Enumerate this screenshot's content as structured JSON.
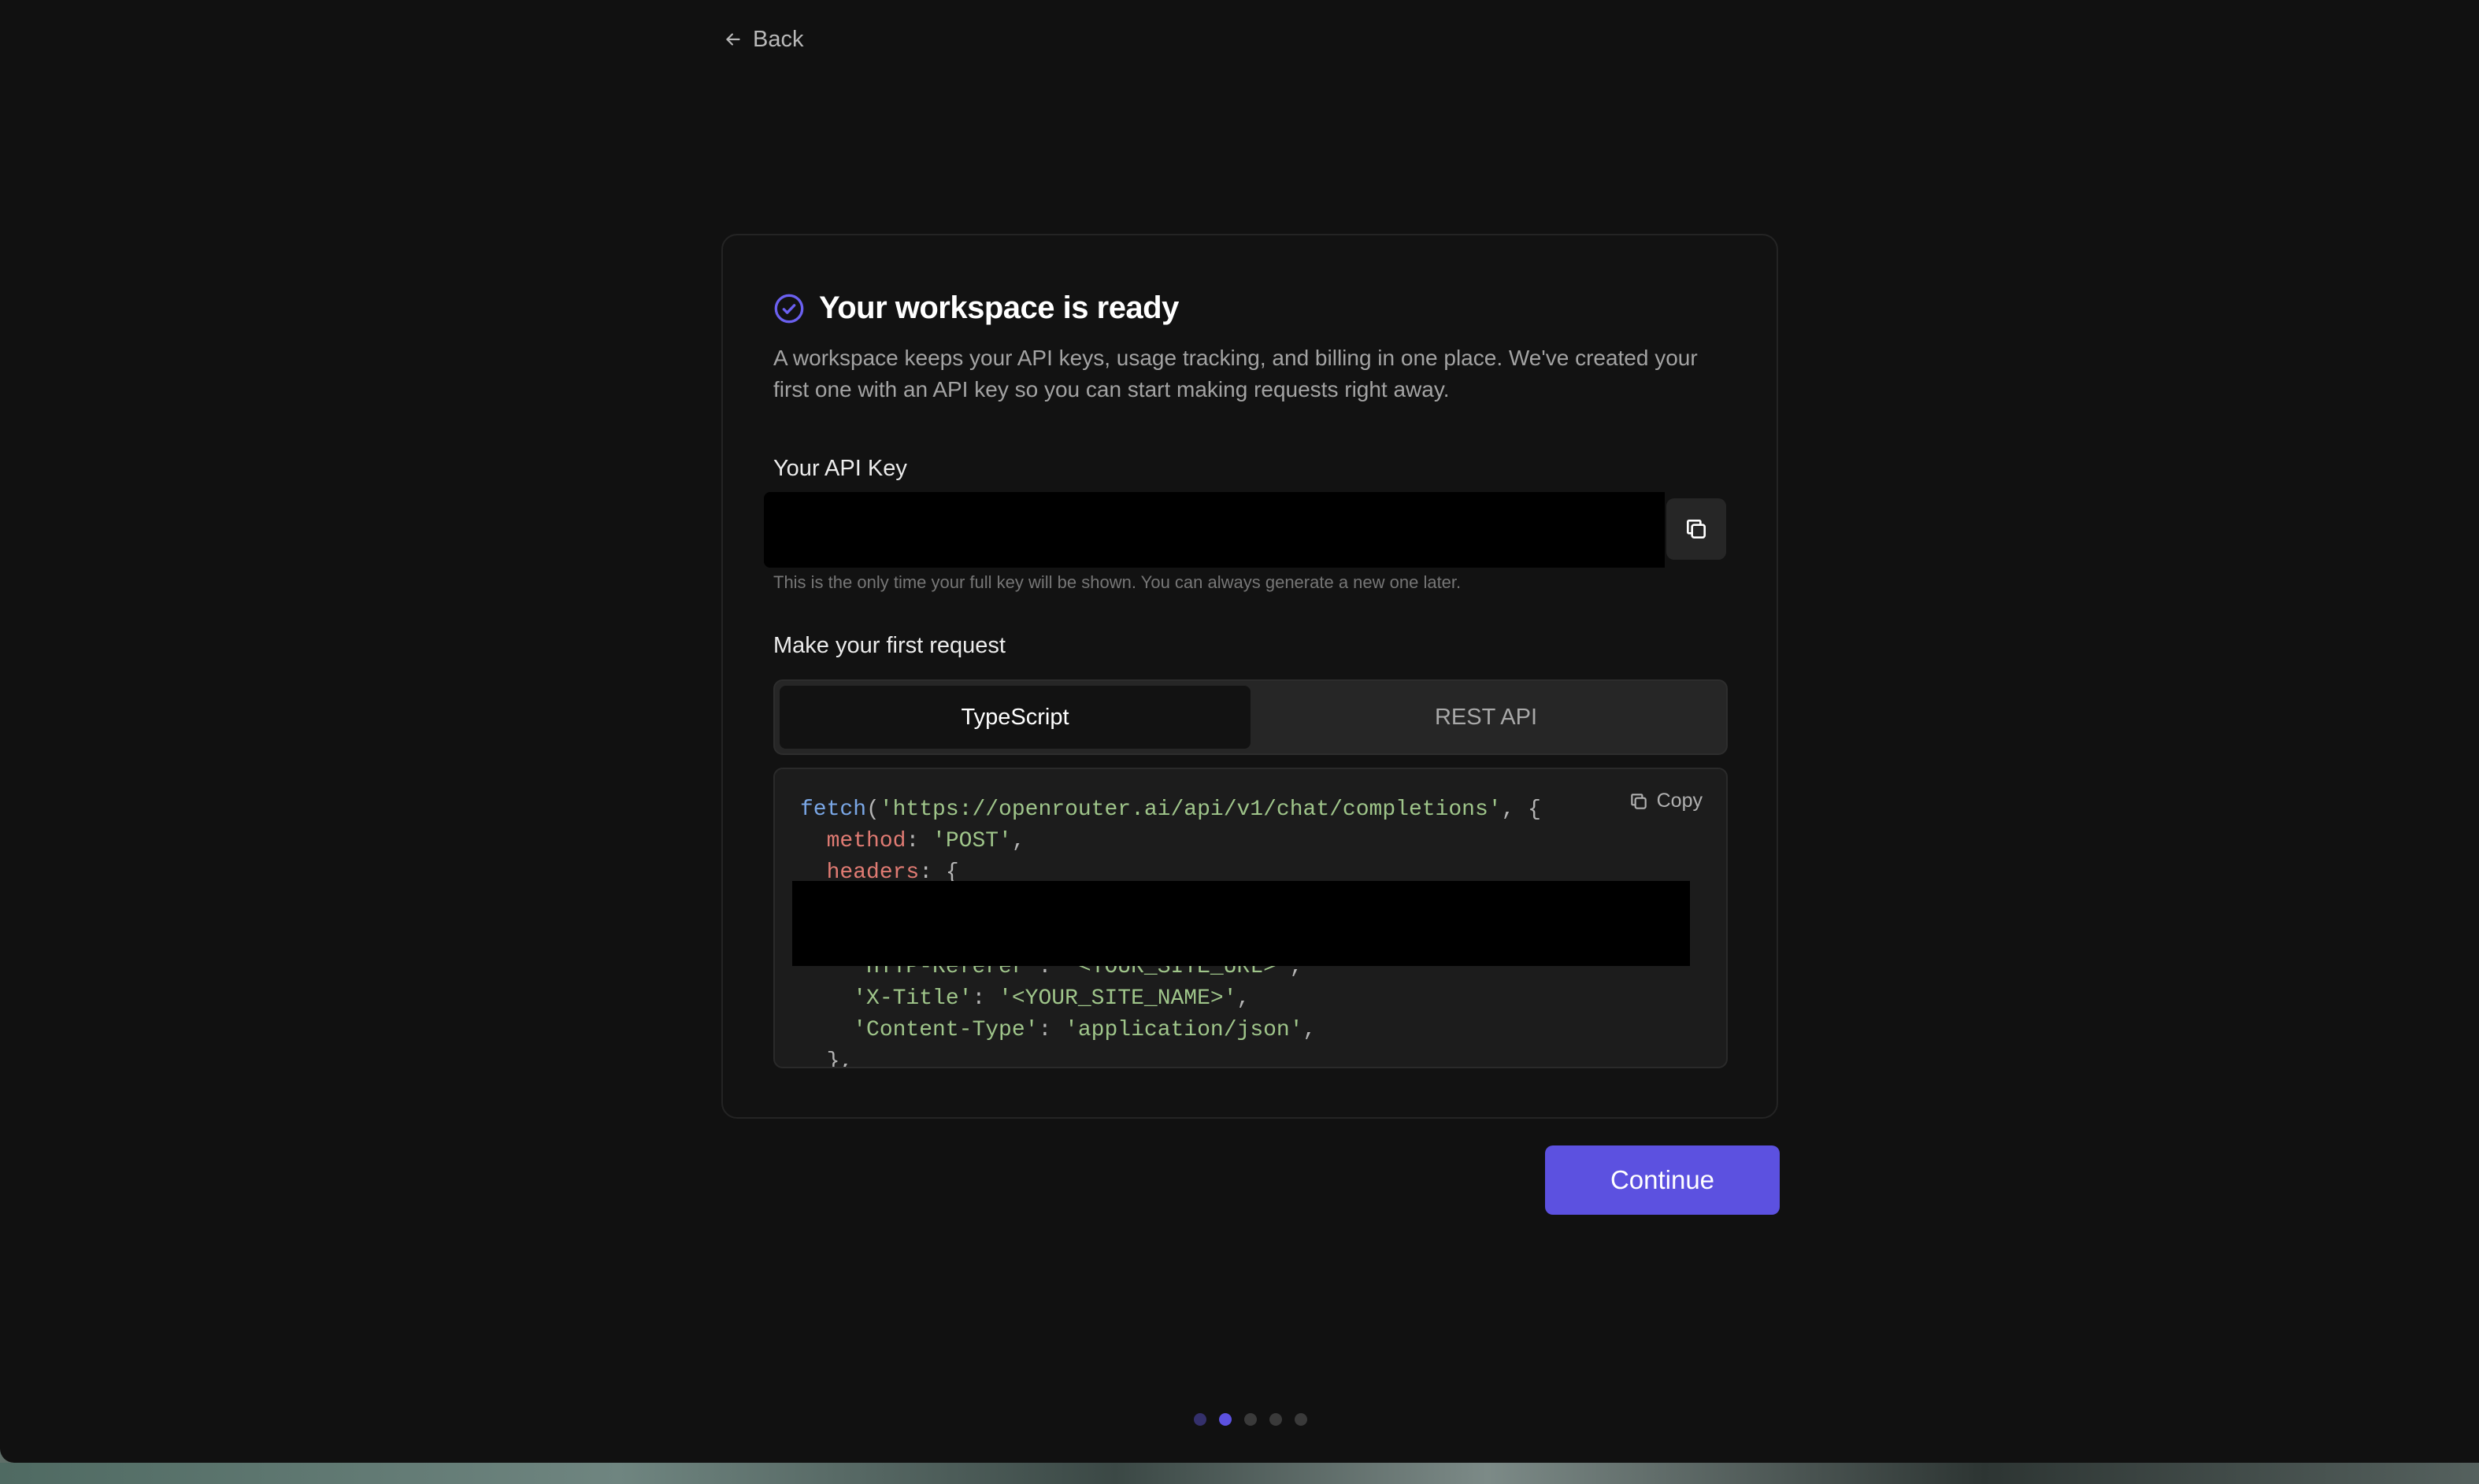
{
  "nav": {
    "back_label": "Back"
  },
  "header": {
    "title": "Your workspace is ready",
    "description": "A workspace keeps your API keys, usage tracking, and billing in one place. We've created your first one with an API key so you can start making requests right away."
  },
  "api_key": {
    "label": "Your API Key",
    "value": "",
    "hint": "This is the only time your full key will be shown. You can always generate a new one later."
  },
  "request": {
    "label": "Make your first request",
    "tabs": [
      {
        "label": "TypeScript",
        "active": true
      },
      {
        "label": "REST API",
        "active": false
      }
    ],
    "copy_label": "Copy",
    "code": {
      "fn": "fetch",
      "url": "'https://openrouter.ai/api/v1/chat/completions'",
      "method_key": "method",
      "method_value": "'POST'",
      "headers_key": "headers",
      "referer_key": "'HTTP-Referer'",
      "referer_value": "'<YOUR_SITE_URL>'",
      "title_key": "'X-Title'",
      "title_value": "'<YOUR_SITE_NAME>'",
      "content_type_key": "'Content-Type'",
      "content_type_value": "'application/json'"
    }
  },
  "footer": {
    "continue_label": "Continue"
  },
  "progress": {
    "total_steps": 5,
    "current_step": 2
  },
  "colors": {
    "accent": "#5c51e0",
    "background": "#111111",
    "card": "#121212"
  }
}
